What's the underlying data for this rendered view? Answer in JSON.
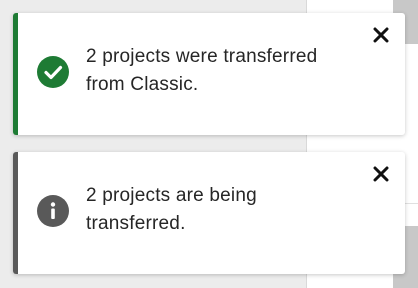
{
  "notifications": [
    {
      "type": "success",
      "icon": "check-circle-icon",
      "accent_color": "#1e7b34",
      "message": "2 projects were transferred from Classic."
    },
    {
      "type": "info",
      "icon": "info-circle-icon",
      "accent_color": "#595959",
      "message": "2 projects are being transferred."
    }
  ]
}
